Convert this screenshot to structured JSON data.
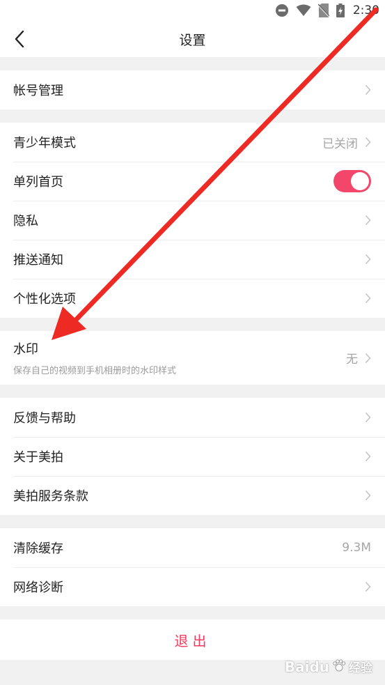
{
  "status_bar": {
    "time": "2:30",
    "icons": [
      "dnd-icon",
      "wifi-icon",
      "no-sim-icon",
      "battery-icon"
    ]
  },
  "header": {
    "title": "设置",
    "back_icon": "back-arrow-icon"
  },
  "groups": [
    [
      {
        "label": "帐号管理"
      }
    ],
    [
      {
        "label": "青少年模式",
        "value": "已关闭"
      },
      {
        "label": "单列首页",
        "toggle": true
      },
      {
        "label": "隐私"
      },
      {
        "label": "推送通知"
      },
      {
        "label": "个性化选项"
      }
    ],
    [
      {
        "label": "水印",
        "subtitle": "保存自己的视频到手机相册时的水印样式",
        "value": "无"
      }
    ],
    [
      {
        "label": "反馈与帮助"
      },
      {
        "label": "关于美拍"
      },
      {
        "label": "美拍服务条款"
      }
    ],
    [
      {
        "label": "清除缓存",
        "value": "9.3M"
      },
      {
        "label": "网络诊断"
      }
    ]
  ],
  "logout": {
    "label": "退出"
  },
  "watermark": {
    "brand": "Baidu",
    "text": "经验"
  },
  "colors": {
    "accent": "#f2476b",
    "annotation_arrow": "#ee2a24",
    "background": "#f1f1f1"
  }
}
